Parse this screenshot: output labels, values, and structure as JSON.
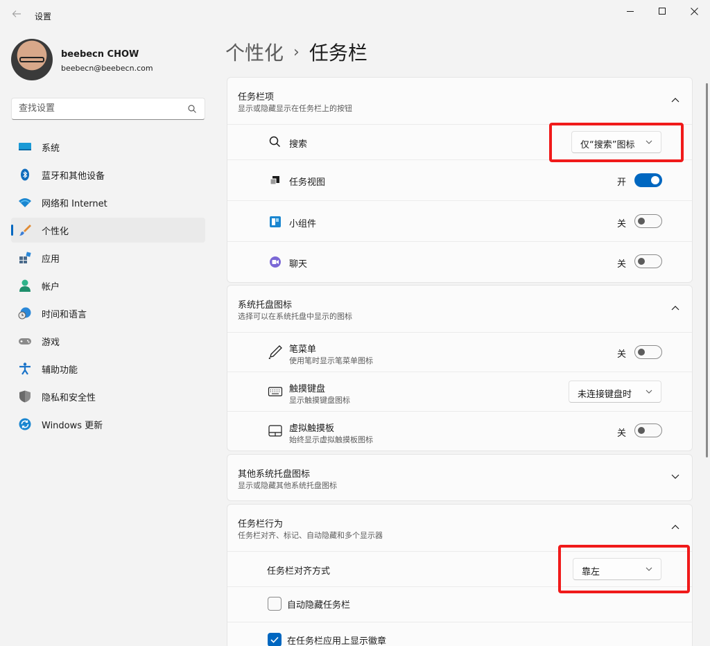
{
  "window": {
    "title": "设置"
  },
  "profile": {
    "name": "beebecn CHOW",
    "email": "beebecn@beebecn.com"
  },
  "search": {
    "placeholder": "查找设置"
  },
  "nav": {
    "items": [
      {
        "label": "系统",
        "icon": "system-icon"
      },
      {
        "label": "蓝牙和其他设备",
        "icon": "bluetooth-icon"
      },
      {
        "label": "网络和 Internet",
        "icon": "wifi-icon"
      },
      {
        "label": "个性化",
        "icon": "brush-icon",
        "active": true
      },
      {
        "label": "应用",
        "icon": "apps-icon"
      },
      {
        "label": "帐户",
        "icon": "account-icon"
      },
      {
        "label": "时间和语言",
        "icon": "globe-clock-icon"
      },
      {
        "label": "游戏",
        "icon": "gamepad-icon"
      },
      {
        "label": "辅助功能",
        "icon": "accessibility-icon"
      },
      {
        "label": "隐私和安全性",
        "icon": "shield-icon"
      },
      {
        "label": "Windows 更新",
        "icon": "update-icon"
      }
    ]
  },
  "breadcrumb": {
    "parent": "个性化",
    "separator": "›",
    "current": "任务栏"
  },
  "taskbar_items": {
    "title": "任务栏项",
    "subtitle": "显示或隐藏显示在任务栏上的按钮",
    "rows": [
      {
        "label": "搜索",
        "control": "dropdown",
        "value": "仅“搜索”图标"
      },
      {
        "label": "任务视图",
        "control": "toggle",
        "state": "开",
        "on": true
      },
      {
        "label": "小组件",
        "control": "toggle",
        "state": "关",
        "on": false
      },
      {
        "label": "聊天",
        "control": "toggle",
        "state": "关",
        "on": false
      }
    ]
  },
  "tray_icons": {
    "title": "系统托盘图标",
    "subtitle": "选择可以在系统托盘中显示的图标",
    "rows": [
      {
        "label": "笔菜单",
        "sub": "使用笔时显示笔菜单图标",
        "control": "toggle",
        "state": "关",
        "on": false
      },
      {
        "label": "触摸键盘",
        "sub": "显示触摸键盘图标",
        "control": "dropdown",
        "value": "未连接键盘时"
      },
      {
        "label": "虚拟触摸板",
        "sub": "始终显示虚拟触摸板图标",
        "control": "toggle",
        "state": "关",
        "on": false
      }
    ]
  },
  "other_tray": {
    "title": "其他系统托盘图标",
    "subtitle": "显示或隐藏其他系统托盘图标"
  },
  "behaviors": {
    "title": "任务栏行为",
    "subtitle": "任务栏对齐、标记、自动隐藏和多个显示器",
    "alignment_label": "任务栏对齐方式",
    "alignment_value": "靠左",
    "autohide_label": "自动隐藏任务栏",
    "autohide_checked": false,
    "badges_label": "在任务栏应用上显示徽章",
    "badges_checked": true
  },
  "colors": {
    "accent": "#0067c0",
    "highlight": "#f01a1a",
    "background": "#f3f3f3"
  }
}
